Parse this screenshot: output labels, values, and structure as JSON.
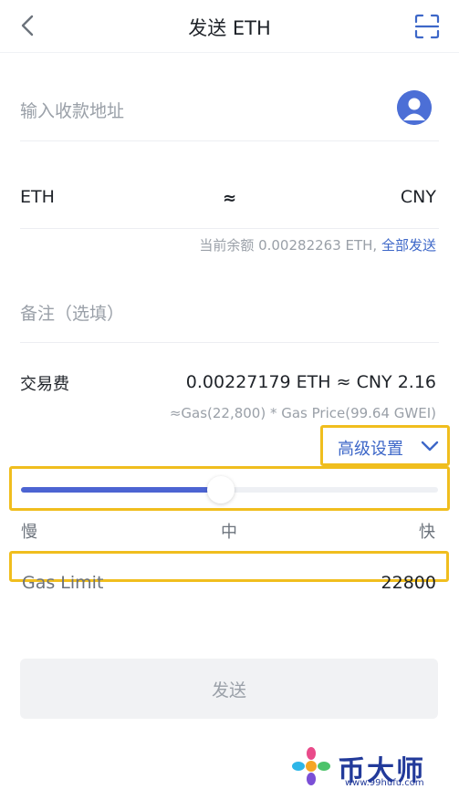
{
  "header": {
    "title": "发送 ETH",
    "back_icon": "chevron-left-icon",
    "scan_icon": "scan-icon"
  },
  "recipient": {
    "placeholder": "输入收款地址",
    "contact_icon": "user-avatar-icon"
  },
  "amount": {
    "left_unit": "ETH",
    "approx": "≈",
    "right_unit": "CNY"
  },
  "balance": {
    "text": "当前余额 0.00282263 ETH,",
    "send_all": "全部发送"
  },
  "memo": {
    "placeholder": "备注（选填）"
  },
  "fee": {
    "label": "交易费",
    "value": "0.00227179 ETH ≈ CNY 2.16",
    "detail": "≈Gas(22,800) * Gas Price(99.64 GWEI)"
  },
  "advanced": {
    "label": "高级设置",
    "icon": "chevron-down-icon"
  },
  "speed_slider": {
    "level": 0.5,
    "slow": "慢",
    "medium": "中",
    "fast": "快"
  },
  "gas_limit": {
    "label": "Gas Limit",
    "value": "22800"
  },
  "actions": {
    "send": "发送"
  },
  "colors": {
    "accent": "#3d67c8",
    "slider_fill": "#4c64d2",
    "highlight": "#f0be1e",
    "muted": "#9aa0a8"
  },
  "watermark": {
    "text": "币大师",
    "url": "www.99hufu.com"
  }
}
